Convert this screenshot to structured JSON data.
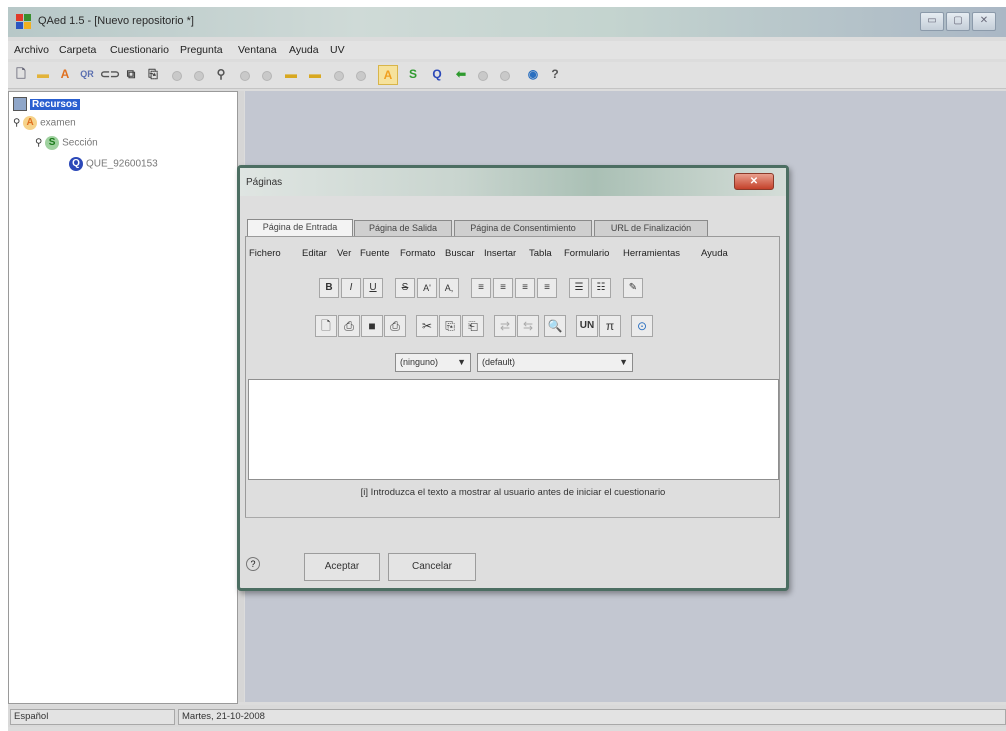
{
  "window": {
    "title": "QAed 1.5 - [Nuevo repositorio *]",
    "controls": [
      "▭",
      "▢",
      "✕"
    ]
  },
  "menubar": [
    "Archivo",
    "Carpeta",
    "Cuestionario",
    "Pregunta",
    "Ventana",
    "Ayuda",
    "UV"
  ],
  "toolbar": {
    "letters": {
      "a": "A",
      "s": "S",
      "q": "Q"
    },
    "accent_colors": {
      "a": "#f0a020",
      "s": "#2f9a2f",
      "q": "#2b48b8"
    }
  },
  "tree": {
    "root": "Recursos",
    "items": [
      {
        "icon": "A",
        "label": "examen"
      },
      {
        "icon": "S",
        "label": "Sección"
      },
      {
        "icon": "Q",
        "label": "QUE_92600153"
      }
    ]
  },
  "dialog": {
    "title": "Páginas",
    "close": "✕",
    "tabs": [
      "Página de Entrada",
      "Página de Salida",
      "Página de Consentimiento",
      "URL de Finalización"
    ],
    "editor_menu": [
      "Fichero",
      "Editar",
      "Ver",
      "Fuente",
      "Formato",
      "Buscar",
      "Insertar",
      "Tabla",
      "Formulario",
      "Herramientas",
      "Ayuda"
    ],
    "format_row1": [
      "B",
      "I",
      "U",
      "S",
      "A'",
      "A,",
      "≡",
      "≡",
      "≡",
      "≡",
      "☰",
      "☷",
      "✎"
    ],
    "format_row2": [
      "🗋",
      "⎙",
      "■",
      "⎙",
      "✂",
      "⎘",
      "⎗",
      "⇄",
      "⇆",
      "🔍",
      "UN",
      "π",
      "⊙"
    ],
    "style_select": "(ninguno)",
    "font_select": "(default)",
    "hint": "[i] Introduzca el texto a mostrar al usuario antes de iniciar el cuestionario",
    "ok_label": "Aceptar",
    "cancel_label": "Cancelar"
  },
  "statusbar": {
    "language": "Español",
    "date": "Martes, 21-10-2008"
  }
}
